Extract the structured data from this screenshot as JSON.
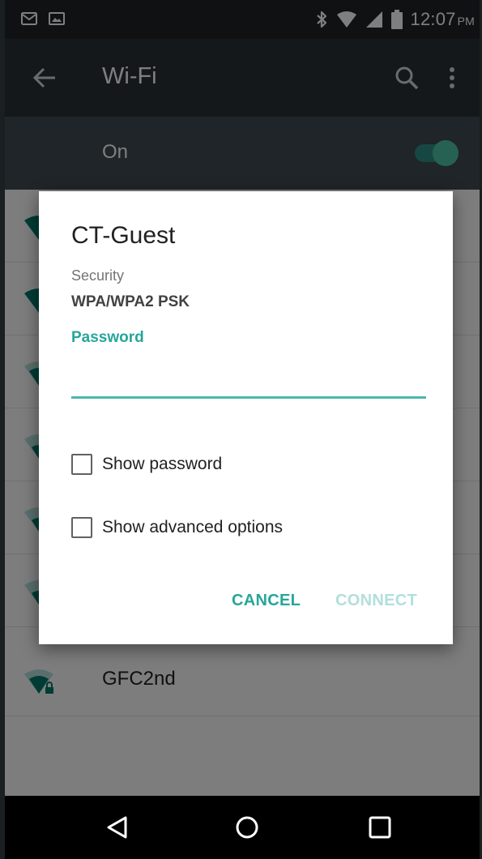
{
  "status_bar": {
    "time": "12:07",
    "ampm": "PM",
    "left_icons": [
      "gmail-icon",
      "image-icon"
    ],
    "right_icons": [
      "bluetooth-icon",
      "wifi-signal-icon",
      "cell-signal-icon",
      "battery-icon"
    ]
  },
  "app_bar": {
    "title": "Wi-Fi",
    "icons": [
      "back-arrow-icon",
      "search-icon",
      "more-vert-icon"
    ]
  },
  "wifi_toggle": {
    "label": "On",
    "state": true
  },
  "networks": [
    {
      "name": "GFC2nd",
      "icon": "wifi-lock-icon"
    }
  ],
  "dialog": {
    "title": "CT-Guest",
    "security_label": "Security",
    "security_value": "WPA/WPA2 PSK",
    "password_label": "Password",
    "password_value": "",
    "show_password_label": "Show password",
    "show_password_checked": false,
    "show_advanced_label": "Show advanced options",
    "show_advanced_checked": false,
    "cancel_label": "CANCEL",
    "connect_label": "CONNECT"
  },
  "colors": {
    "accent": "#26a69a",
    "accent_disabled": "#b2dfdb",
    "app_bar": "#2b3134",
    "on_row": "#3f4b51"
  },
  "nav_bar": {
    "icons": [
      "back-triangle-icon",
      "home-circle-icon",
      "recents-square-icon"
    ]
  }
}
